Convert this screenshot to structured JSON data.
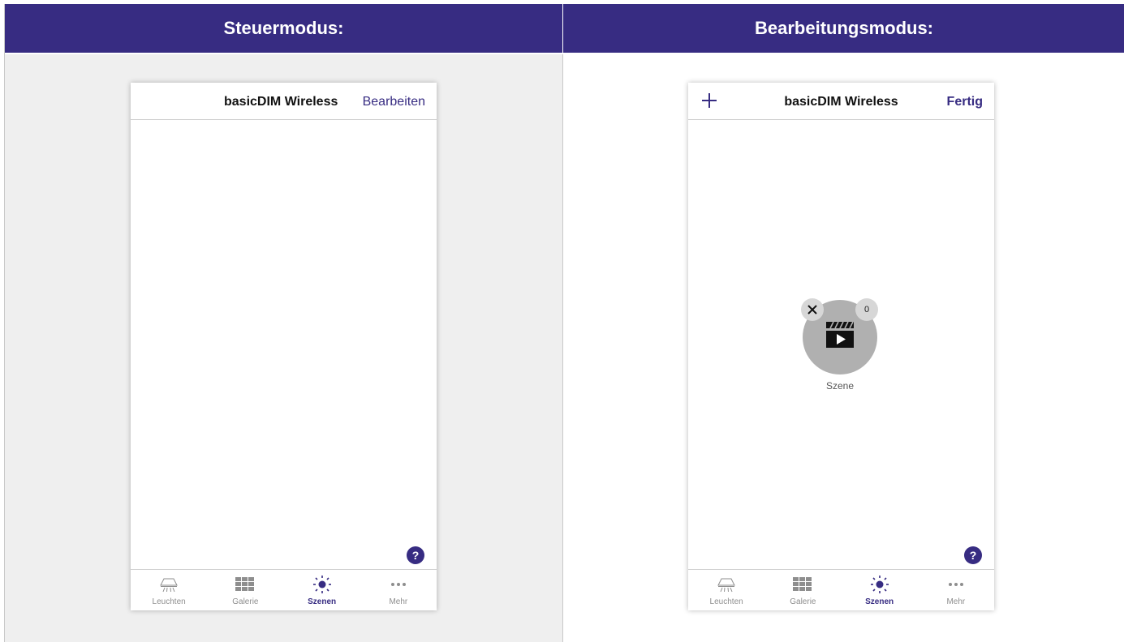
{
  "colors": {
    "accent": "#372c82",
    "panel_bg": "#efefef",
    "scene_bg": "#b0b0b0",
    "inactive": "#8e8e8e"
  },
  "left": {
    "header": "Steuermodus:",
    "app": {
      "title": "basicDIM Wireless",
      "right_button": "Bearbeiten",
      "help": "?"
    }
  },
  "right": {
    "header": "Bearbeitungsmodus:",
    "app": {
      "title": "basicDIM Wireless",
      "left_icon": "plus-icon",
      "right_button": "Fertig",
      "help": "?",
      "scene": {
        "label": "Szene",
        "count": "0",
        "icon": "clapperboard-play-icon",
        "delete_icon": "close-icon"
      }
    }
  },
  "tabs": [
    {
      "label": "Leuchten",
      "icon": "lamp-icon",
      "active": false
    },
    {
      "label": "Galerie",
      "icon": "grid-icon",
      "active": false
    },
    {
      "label": "Szenen",
      "icon": "sun-icon",
      "active": true
    },
    {
      "label": "Mehr",
      "icon": "more-icon",
      "active": false
    }
  ]
}
